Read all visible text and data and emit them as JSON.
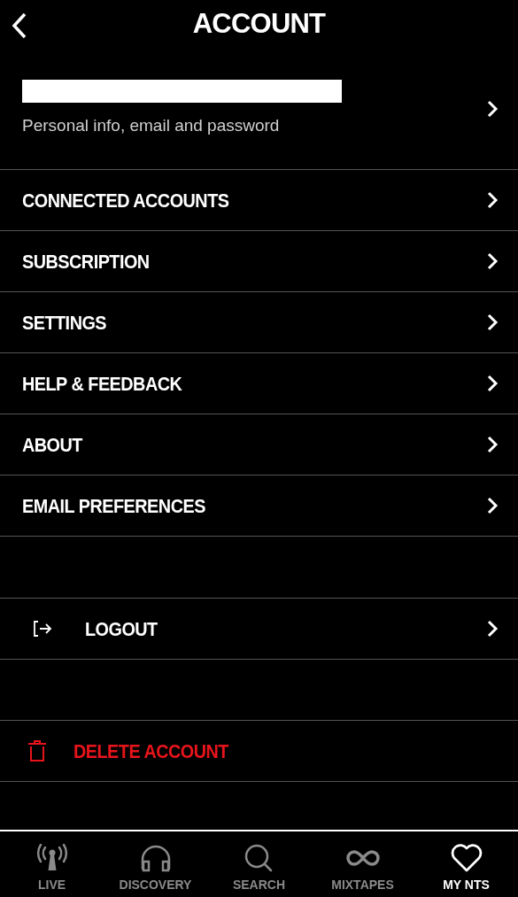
{
  "header": {
    "title": "ACCOUNT"
  },
  "profile": {
    "subtitle": "Personal info, email and password"
  },
  "menu": [
    {
      "label": "CONNECTED ACCOUNTS"
    },
    {
      "label": "SUBSCRIPTION"
    },
    {
      "label": "SETTINGS"
    },
    {
      "label": "HELP & FEEDBACK"
    },
    {
      "label": "ABOUT"
    },
    {
      "label": "EMAIL PREFERENCES"
    }
  ],
  "logout": {
    "label": "LOGOUT"
  },
  "delete": {
    "label": "DELETE ACCOUNT"
  },
  "tabs": [
    {
      "label": "LIVE",
      "kind": "antenna",
      "selected": false
    },
    {
      "label": "DISCOVERY",
      "kind": "headphones",
      "selected": false
    },
    {
      "label": "SEARCH",
      "kind": "search",
      "selected": false
    },
    {
      "label": "MIXTAPES",
      "kind": "infinity",
      "selected": false
    },
    {
      "label": "MY NTS",
      "kind": "heart",
      "selected": true
    }
  ]
}
